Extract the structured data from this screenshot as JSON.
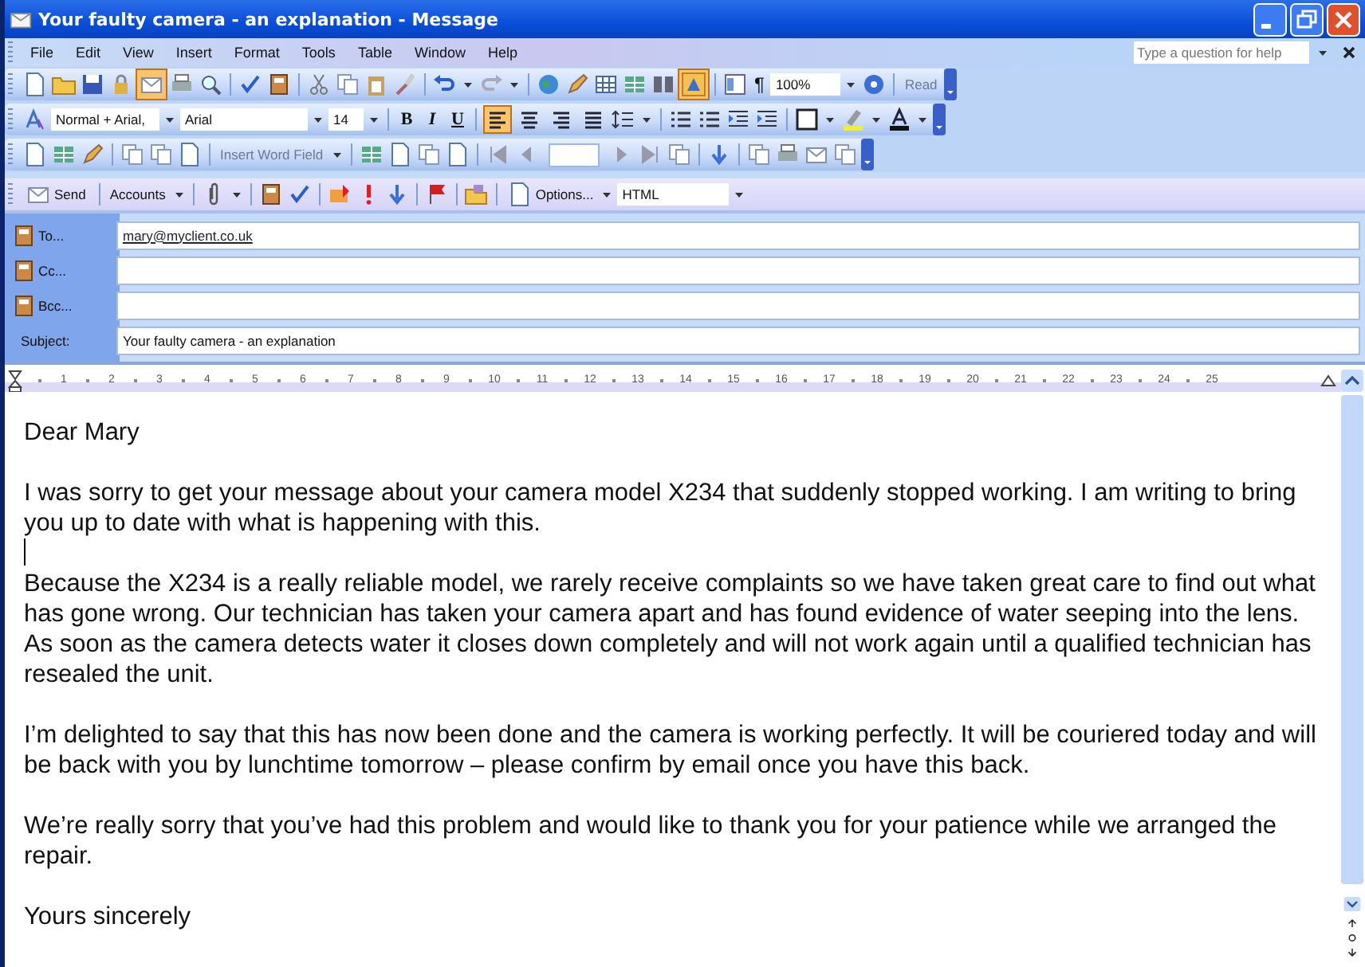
{
  "window": {
    "title": "Your faulty camera - an explanation - Message"
  },
  "menu": [
    "File",
    "Edit",
    "View",
    "Insert",
    "Format",
    "Tools",
    "Table",
    "Window",
    "Help"
  ],
  "help_box": {
    "placeholder": "Type a question for help"
  },
  "standard_toolbar": {
    "zoom": "100%",
    "pilcrow": "¶",
    "read": "Read"
  },
  "formatting_toolbar": {
    "style": "Normal + Arial,",
    "font": "Arial",
    "size": "14",
    "bold": "B",
    "italic": "I",
    "underline": "U",
    "alignment": [
      {
        "selected": true
      },
      {
        "selected": false
      },
      {
        "selected": false
      },
      {
        "selected": false
      }
    ]
  },
  "mail_merge_toolbar": {
    "insert_field": "Insert Word Field"
  },
  "email_toolbar": {
    "send": "Send",
    "accounts": "Accounts",
    "options": "Options...",
    "format": "HTML"
  },
  "header": {
    "to": {
      "label": "To...",
      "value": "mary@myclient.co.uk"
    },
    "cc": {
      "label": "Cc..."
    },
    "bcc": {
      "label": "Bcc..."
    },
    "subject": {
      "label": "Subject:",
      "value": "Your faulty camera - an explanation"
    }
  },
  "ruler": [
    "1",
    "2",
    "3",
    "4",
    "5",
    "6",
    "7",
    "8",
    "9",
    "10",
    "11",
    "12",
    "13",
    "14",
    "15",
    "16",
    "17",
    "18",
    "19",
    "20",
    "21",
    "22",
    "23",
    "24",
    "25"
  ],
  "body": [
    {
      "kind": "text",
      "text": "Dear Mary"
    },
    {
      "kind": "text",
      "text": "I was sorry to get your message about your camera model X234 that suddenly stopped working. I am writing to bring you up to date with what is happening with this."
    },
    {
      "kind": "cursor"
    },
    {
      "kind": "text",
      "text": "Because the X234 is a really reliable model, we rarely receive complaints so we have taken great care to find out what has gone wrong. Our technician has taken your camera apart and has found evidence of water seeping into the lens. As soon as the camera detects water it closes down completely and will not work again until a qualified technician has resealed the unit."
    },
    {
      "kind": "text",
      "text": "I’m delighted to say that this has now been done and the camera is working perfectly. It will be couriered today and will be back with you by lunchtime tomorrow – please confirm by email once you have this back."
    },
    {
      "kind": "text",
      "text": "We’re really sorry that you’ve had this problem and would like to thank you for your patience while we arranged the repair."
    },
    {
      "kind": "text",
      "text": "Yours sincerely"
    }
  ]
}
